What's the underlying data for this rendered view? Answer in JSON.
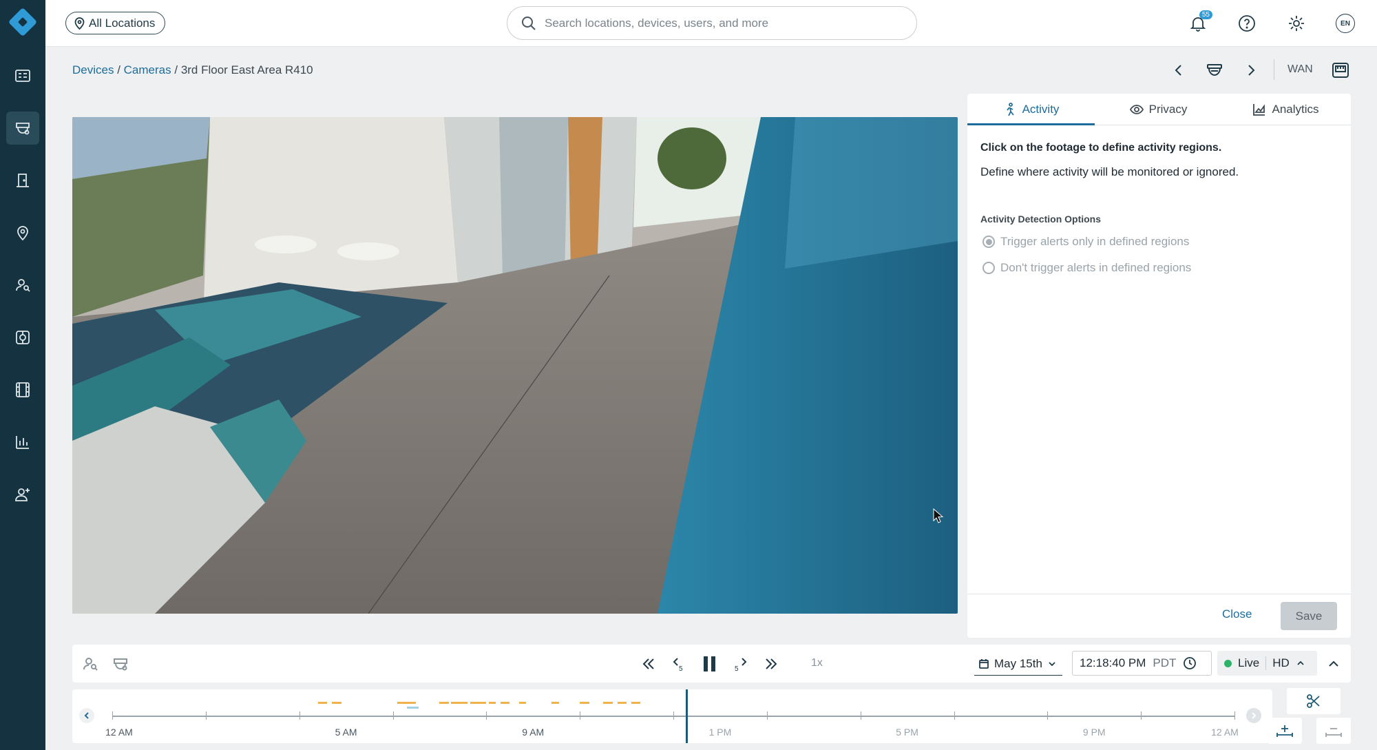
{
  "topbar": {
    "location_button": "All Locations",
    "search_placeholder": "Search locations, devices, users, and more",
    "notifications_count": "55",
    "language": "EN"
  },
  "sidebar": {
    "items": [
      {
        "name": "dashboard",
        "icon": "dashboard-icon",
        "active": false
      },
      {
        "name": "cameras",
        "icon": "camera-icon",
        "active": true
      },
      {
        "name": "access-control",
        "icon": "door-icon",
        "active": false
      },
      {
        "name": "locations",
        "icon": "location-pin-icon",
        "active": false
      },
      {
        "name": "people-search",
        "icon": "person-search-icon",
        "active": false
      },
      {
        "name": "analytics-ai",
        "icon": "ai-chip-icon",
        "active": false
      },
      {
        "name": "video-library",
        "icon": "film-icon",
        "active": false
      },
      {
        "name": "reports",
        "icon": "bar-chart-icon",
        "active": false
      },
      {
        "name": "users",
        "icon": "add-user-icon",
        "active": false
      }
    ]
  },
  "breadcrumb": {
    "devices": "Devices",
    "cameras": "Cameras",
    "current": "3rd Floor East Area R410",
    "network": "WAN"
  },
  "panel": {
    "tabs": [
      {
        "label": "Activity",
        "icon": "person-walking-icon",
        "active": true
      },
      {
        "label": "Privacy",
        "icon": "eye-icon",
        "active": false
      },
      {
        "label": "Analytics",
        "icon": "area-chart-icon",
        "active": false
      }
    ],
    "title": "Click on the footage to define activity regions.",
    "description": "Define where activity will be monitored or ignored.",
    "options_heading": "Activity Detection Options",
    "options": [
      {
        "label": "Trigger alerts only in defined regions",
        "checked": true
      },
      {
        "label": "Don't trigger alerts in defined regions",
        "checked": false
      }
    ],
    "close_label": "Close",
    "save_label": "Save"
  },
  "playback": {
    "speed": "1x",
    "date": "May 15th",
    "time": "12:18:40 PM",
    "timezone": "PDT",
    "live_label": "Live",
    "quality": "HD"
  },
  "timeline": {
    "labels": [
      "12 AM",
      "5 AM",
      "9 AM",
      "1 PM",
      "5 PM",
      "9 PM",
      "12 AM"
    ],
    "playhead_time": "12:18 PM",
    "colors": {
      "motion": "#f0b24a",
      "person": "#9fd0e6",
      "playhead": "#1c5a78"
    }
  },
  "colors": {
    "sidebar_bg": "#14323f",
    "accent": "#1c6d9c",
    "live": "#2fb36b"
  }
}
